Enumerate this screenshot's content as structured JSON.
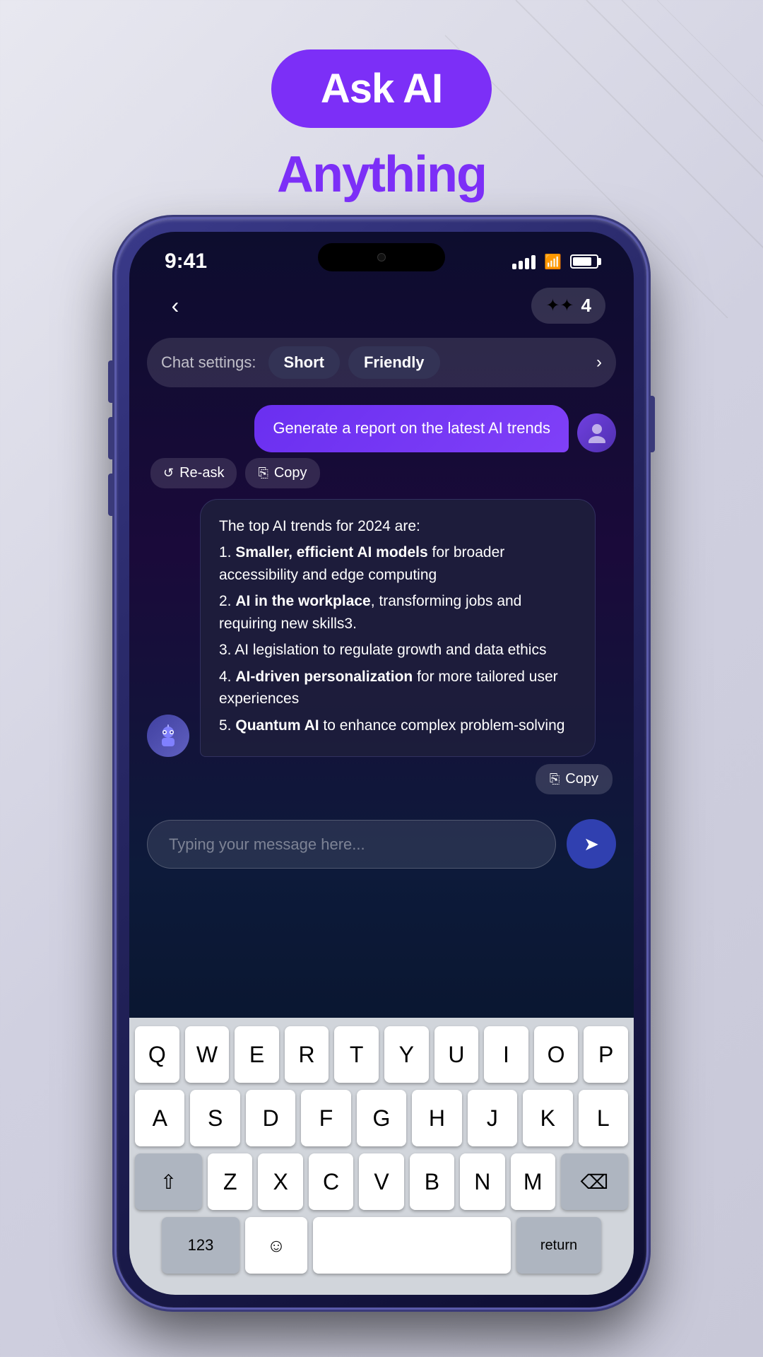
{
  "header": {
    "badge_text": "Ask AI",
    "subtitle": "Anything"
  },
  "phone": {
    "status_bar": {
      "time": "9:41",
      "signal": "●●●●",
      "wifi": "WiFi",
      "battery": "Battery"
    },
    "nav": {
      "back_label": "‹",
      "credits_count": "4"
    },
    "chat_settings": {
      "label": "Chat settings:",
      "chip1": "Short",
      "chip2": "Friendly",
      "chevron": "›"
    },
    "user_message": {
      "text": "Generate a report on the latest AI trends",
      "avatar": "👤"
    },
    "message_actions": {
      "reask_label": "Re-ask",
      "copy_label": "Copy"
    },
    "ai_response": {
      "avatar": "🤖",
      "intro": "The top AI trends for 2024 are:",
      "items": [
        {
          "number": "1.",
          "bold": "Smaller, efficient AI models",
          "rest": " for broader accessibility and edge computing"
        },
        {
          "number": "2.",
          "bold": "AI in the workplace",
          "rest": ", transforming jobs and requiring new skills3."
        },
        {
          "number": "3.",
          "bold": "",
          "rest": "AI legislation to regulate growth and data ethics"
        },
        {
          "number": "4.",
          "bold": "AI-driven personalization",
          "rest": " for more tailored user experiences"
        },
        {
          "number": "5.",
          "bold": "Quantum AI",
          "rest": " to enhance complex problem-solving"
        }
      ]
    },
    "copy_button": {
      "label": "Copy"
    },
    "input": {
      "placeholder": "Typing your message here..."
    },
    "keyboard": {
      "row1": [
        "Q",
        "W",
        "E",
        "R",
        "T",
        "Y",
        "U",
        "I",
        "O",
        "P"
      ],
      "row2": [
        "A",
        "S",
        "D",
        "F",
        "G",
        "H",
        "J",
        "K",
        "L"
      ],
      "row3": [
        "Z",
        "X",
        "C",
        "V",
        "B",
        "N",
        "M"
      ],
      "shift_label": "⇧",
      "delete_label": "⌫",
      "space_label": ""
    }
  }
}
